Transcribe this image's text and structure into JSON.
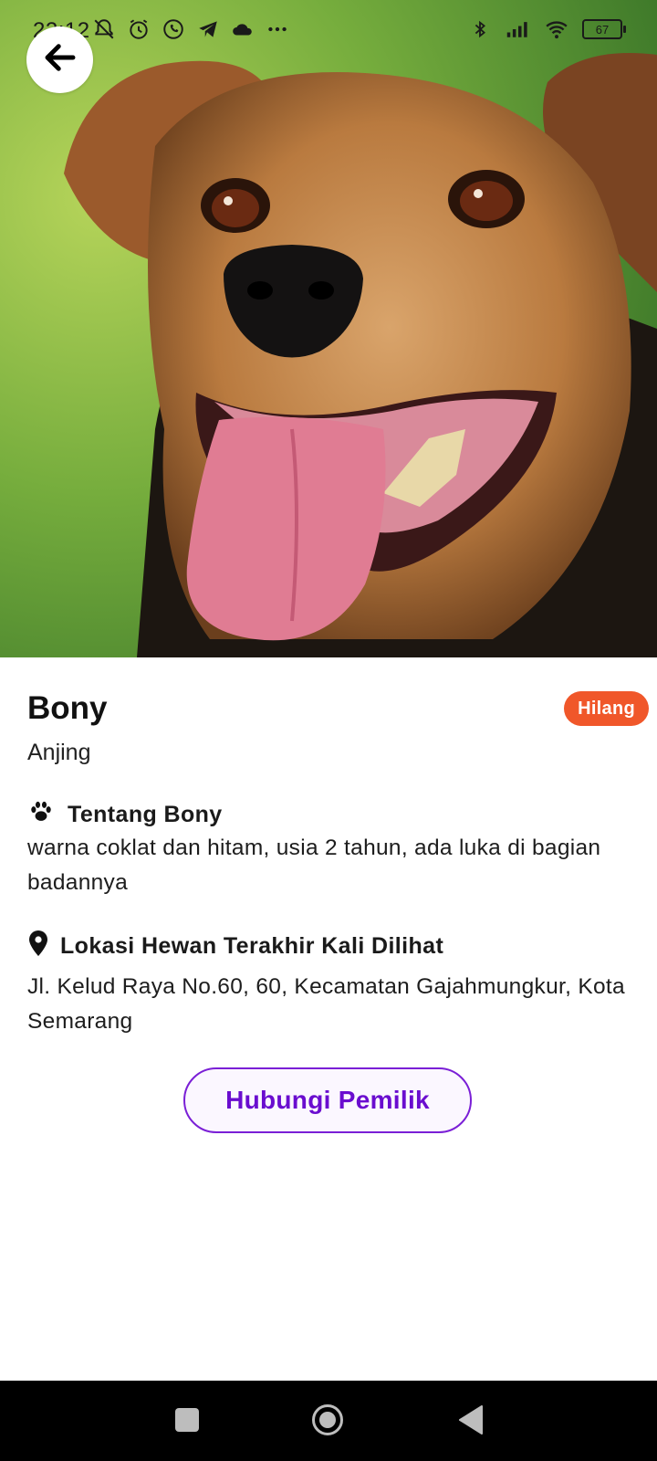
{
  "status_bar": {
    "time": "22:12",
    "left_icons": [
      "muted-bell-icon",
      "alarm-icon",
      "whatsapp-icon",
      "telegram-icon",
      "cloud-icon",
      "more-dots-icon"
    ],
    "right_icons": [
      "bluetooth-icon",
      "signal-icon",
      "wifi-icon"
    ],
    "battery": "67"
  },
  "hero": {
    "subject": "dog-photo"
  },
  "pet": {
    "name": "Bony",
    "species": "Anjing",
    "status_badge": "Hilang",
    "status_color": "#f0572a"
  },
  "about": {
    "heading": "Tentang Bony",
    "icon": "paw-icon",
    "text": "warna coklat dan hitam, usia 2 tahun, ada luka di bagian badannya"
  },
  "location": {
    "heading": "Lokasi Hewan Terakhir Kali Dilihat",
    "icon": "location-pin-icon",
    "text": "Jl. Kelud Raya No.60, 60, Kecamatan Gajahmungkur, Kota Semarang"
  },
  "contact_button": {
    "label": "Hubungi Pemilik",
    "accent": "#6a0dcf"
  },
  "nav_bar": {
    "buttons": [
      "recents",
      "home",
      "back"
    ]
  }
}
